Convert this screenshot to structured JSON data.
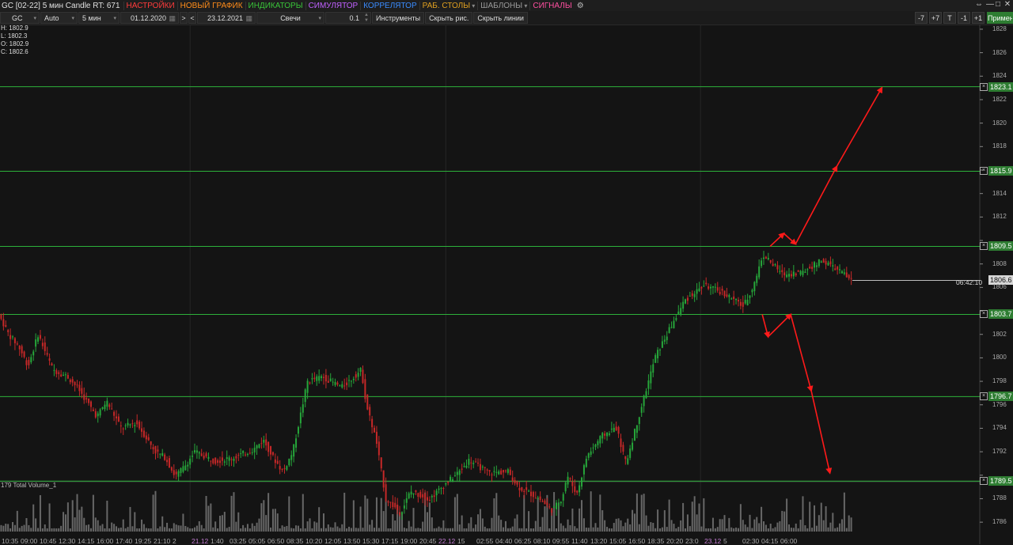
{
  "titlebar": {
    "title": "GC [02-22] 5 мин Candle RT: 671",
    "menus": [
      {
        "label": "НАСТРОЙКИ",
        "color": "#ff3b3b",
        "dropdown": false
      },
      {
        "label": "НОВЫЙ ГРАФИК",
        "color": "#ff8c1a",
        "dropdown": false
      },
      {
        "label": "ИНДИКАТОРЫ",
        "color": "#39c439",
        "dropdown": false
      },
      {
        "label": "СИМУЛЯТОР",
        "color": "#c060ff",
        "dropdown": false
      },
      {
        "label": "КОРРЕЛЯТОР",
        "color": "#3a8cff",
        "dropdown": false
      },
      {
        "label": "РАБ. СТОЛЫ",
        "color": "#e0a020",
        "dropdown": true
      },
      {
        "label": "ШАБЛОНЫ",
        "color": "#9a9a9a",
        "dropdown": true
      },
      {
        "label": "СИГНАЛЫ",
        "color": "#ff4fa0",
        "dropdown": false
      }
    ],
    "gear_icon": "gears-icon",
    "window_controls": [
      "⇔",
      "—",
      "□",
      "✕"
    ]
  },
  "toolbar": {
    "symbol": "GC",
    "scale": "Auto",
    "timeframe": "5 мин",
    "date_from": "01.12.2020",
    "next": ">",
    "prev": "<",
    "date_to": "23.12.2021",
    "chart_type": "Свечи",
    "step": "0.1",
    "instruments": "Инструменты",
    "hide_drawings": "Скрыть рис.",
    "hide_lines": "Скрыть линии",
    "right_buttons": [
      "-7",
      "+7",
      "T",
      "-1",
      "+1"
    ],
    "apply": "Примен"
  },
  "ohlc": {
    "h": "H: 1802.9",
    "l": "L: 1802.3",
    "o": "O: 1802.9",
    "c": "C: 1802.6"
  },
  "volume_label": "Total Volume_1",
  "volume_scale": "179",
  "time_flag": "06:42:10",
  "colors": {
    "up": "#26a63a",
    "down": "#c62828",
    "level": "#2db13a",
    "arrow": "#ff1a1a",
    "volume": "#8a8a8a"
  },
  "chart_data": {
    "type": "candlestick",
    "yticks": [
      1786,
      1788,
      1790,
      1792,
      1794,
      1796,
      1798,
      1800,
      1802,
      1804,
      1806,
      1808,
      1810,
      1812,
      1814,
      1816,
      1818,
      1820,
      1822,
      1824,
      1826,
      1828
    ],
    "ylim": [
      1785.2,
      1828.4
    ],
    "levels": [
      {
        "price": 1823.1,
        "label": "1823.1"
      },
      {
        "price": 1815.9,
        "label": "1815.9"
      },
      {
        "price": 1809.5,
        "label": "1809.5"
      },
      {
        "price": 1803.7,
        "label": "1803.7"
      },
      {
        "price": 1796.7,
        "label": "1796.7"
      },
      {
        "price": 1789.5,
        "label": "1789.5"
      }
    ],
    "current_price": {
      "price": 1806.6,
      "label": "1806.6"
    },
    "time_labels": [
      "10:35",
      "09:00",
      "10:45",
      "12:30",
      "14:15",
      "16:00",
      "17:40",
      "19:25",
      "21:10",
      "2",
      "21.12",
      "1:40",
      "03:25",
      "05:05",
      "06:50",
      "08:35",
      "10:20",
      "12:05",
      "13:50",
      "15:30",
      "17:15",
      "19:00",
      "20:45",
      "22.12",
      "15",
      "02:55",
      "04:40",
      "06:25",
      "08:10",
      "09:55",
      "11:40",
      "13:20",
      "15:05",
      "16:50",
      "18:35",
      "20:20",
      "23:0",
      "23.12",
      "5",
      "02:30",
      "04:15",
      "06:00"
    ],
    "price_path": [
      [
        1803.7,
        0
      ],
      [
        1802,
        0.01
      ],
      [
        1801,
        0.02
      ],
      [
        1799.3,
        0.03
      ],
      [
        1802,
        0.04
      ],
      [
        1799,
        0.055
      ],
      [
        1798.4,
        0.07
      ],
      [
        1797.5,
        0.08
      ],
      [
        1795,
        0.1
      ],
      [
        1796.3,
        0.11
      ],
      [
        1794,
        0.125
      ],
      [
        1794.5,
        0.14
      ],
      [
        1792,
        0.16
      ],
      [
        1791.5,
        0.17
      ],
      [
        1789.9,
        0.18
      ],
      [
        1790.8,
        0.19
      ],
      [
        1792,
        0.2
      ],
      [
        1791.2,
        0.22
      ],
      [
        1791.5,
        0.24
      ],
      [
        1792.2,
        0.26
      ],
      [
        1793,
        0.27
      ],
      [
        1791.5,
        0.28
      ],
      [
        1790.3,
        0.29
      ],
      [
        1792,
        0.3
      ],
      [
        1794,
        0.305
      ],
      [
        1798,
        0.315
      ],
      [
        1798.4,
        0.33
      ],
      [
        1797.5,
        0.35
      ],
      [
        1798.2,
        0.36
      ],
      [
        1799,
        0.37
      ],
      [
        1796,
        0.375
      ],
      [
        1793,
        0.385
      ],
      [
        1788,
        0.395
      ],
      [
        1786.8,
        0.41
      ],
      [
        1788.6,
        0.42
      ],
      [
        1788,
        0.44
      ],
      [
        1789.2,
        0.455
      ],
      [
        1790.3,
        0.47
      ],
      [
        1791.3,
        0.48
      ],
      [
        1790.2,
        0.5
      ],
      [
        1790.3,
        0.52
      ],
      [
        1789,
        0.53
      ],
      [
        1788.1,
        0.55
      ],
      [
        1787,
        0.565
      ],
      [
        1788.1,
        0.575
      ],
      [
        1790,
        0.58
      ],
      [
        1788.4,
        0.59
      ],
      [
        1791.6,
        0.6
      ],
      [
        1793.3,
        0.615
      ],
      [
        1794.1,
        0.63
      ],
      [
        1791,
        0.64
      ],
      [
        1797.1,
        0.66
      ],
      [
        1800.1,
        0.67
      ],
      [
        1802.5,
        0.685
      ],
      [
        1804.9,
        0.7
      ],
      [
        1806.2,
        0.72
      ],
      [
        1805.5,
        0.74
      ],
      [
        1804.4,
        0.76
      ],
      [
        1806.1,
        0.77
      ],
      [
        1808.8,
        0.78
      ],
      [
        1807.1,
        0.8
      ],
      [
        1807.3,
        0.82
      ],
      [
        1808.3,
        0.84
      ],
      [
        1807.3,
        0.86
      ],
      [
        1806.6,
        0.87
      ]
    ],
    "arrows": [
      {
        "from": [
          1809.5,
          0.786
        ],
        "to": [
          1810.6,
          0.8
        ]
      },
      {
        "from": [
          1810.6,
          0.8
        ],
        "to": [
          1809.7,
          0.812
        ]
      },
      {
        "from": [
          1809.7,
          0.812
        ],
        "to": [
          1816.3,
          0.854
        ]
      },
      {
        "from": [
          1816.3,
          0.854
        ],
        "to": [
          1823.0,
          0.9
        ]
      },
      {
        "from": [
          1803.7,
          0.778
        ],
        "to": [
          1801.8,
          0.784
        ]
      },
      {
        "from": [
          1801.8,
          0.784
        ],
        "to": [
          1803.7,
          0.807
        ]
      },
      {
        "from": [
          1803.7,
          0.807
        ],
        "to": [
          1797.2,
          0.828
        ]
      },
      {
        "from": [
          1797.2,
          0.828
        ],
        "to": [
          1790.2,
          0.847
        ]
      }
    ]
  }
}
